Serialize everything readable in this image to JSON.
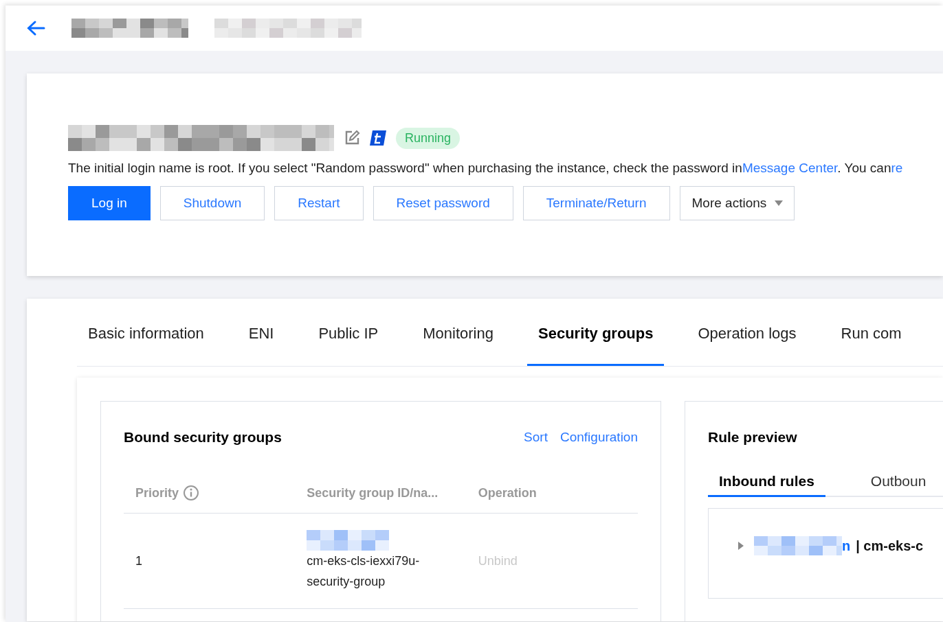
{
  "instance": {
    "status": "Running"
  },
  "notice": [
    {
      "kind": "text",
      "text": "The initial login name is root. If you select \"Random password\" when purchasing the instance, check the password in"
    },
    {
      "kind": "link",
      "text": "Message Center"
    },
    {
      "kind": "text",
      "text": ". You can"
    },
    {
      "kind": "link",
      "text": "re"
    }
  ],
  "actions": [
    {
      "label": "Log in",
      "kind": "primary"
    },
    {
      "label": "Shutdown",
      "kind": "link"
    },
    {
      "label": "Restart",
      "kind": "link"
    },
    {
      "label": "Reset password",
      "kind": "link"
    },
    {
      "label": "Terminate/Return",
      "kind": "link"
    },
    {
      "label": "More actions",
      "kind": "dropdown"
    }
  ],
  "tabs": [
    {
      "label": "Basic information",
      "selected": false
    },
    {
      "label": "ENI",
      "selected": false
    },
    {
      "label": "Public IP",
      "selected": false
    },
    {
      "label": "Monitoring",
      "selected": false
    },
    {
      "label": "Security groups",
      "selected": true
    },
    {
      "label": "Operation logs",
      "selected": false
    },
    {
      "label": "Run com",
      "selected": false
    }
  ],
  "bound_groups": {
    "title": "Bound security groups",
    "links": [
      "Sort",
      "Configuration"
    ],
    "columns": [
      {
        "label": "Priority",
        "info": true
      },
      {
        "label": "Security group ID/na...",
        "info": false
      },
      {
        "label": "Operation",
        "info": false
      }
    ],
    "rows": [
      {
        "priority": "1",
        "group_name": "cm-eks-cls-iexxi79u-security-group",
        "operation": "Unbind",
        "disabled": true
      }
    ]
  },
  "rule_preview": {
    "title": "Rule preview",
    "tabs": [
      {
        "label": "Inbound rules",
        "selected": true
      },
      {
        "label": "Outboun",
        "selected": false
      }
    ],
    "rules": [
      {
        "name_tail": "n",
        "group": "| cm-eks-c",
        "expanded": false
      }
    ]
  }
}
